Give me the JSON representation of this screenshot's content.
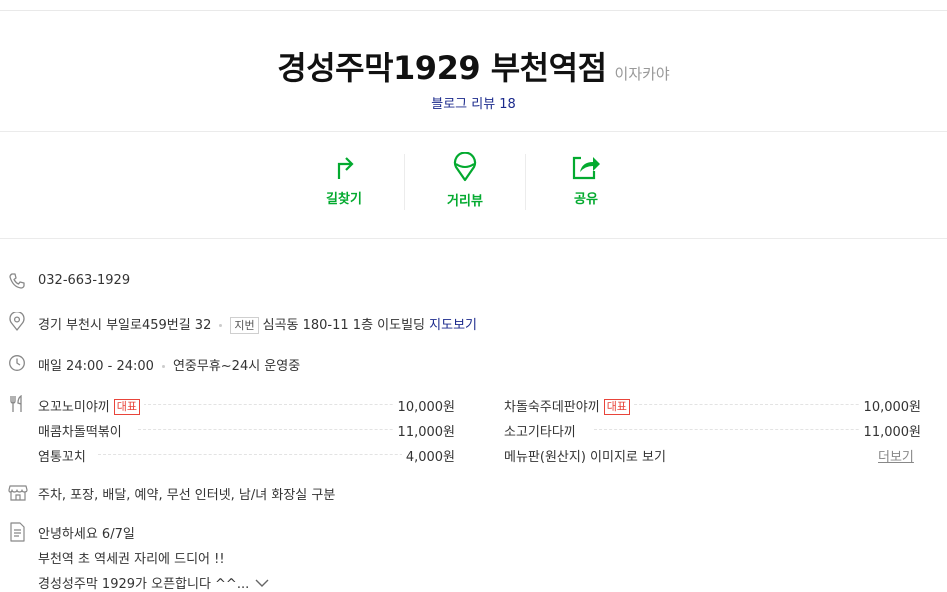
{
  "header": {
    "title": "경성주막1929 부천역점",
    "category": "이자카야",
    "review_label": "블로그 리뷰",
    "review_count": "18"
  },
  "actions": {
    "directions": "길찾기",
    "street_view": "거리뷰",
    "share": "공유"
  },
  "info": {
    "phone": "032-663-1929",
    "address_road": "경기 부천시 부일로459번길 32",
    "jibun_tag": "지번",
    "address_jibun": "심곡동 180-11 1층 이도빌딩",
    "map_link": "지도보기",
    "hours": "매일 24:00 - 24:00",
    "hours_note": "연중무휴~24시 운영중",
    "facilities": "주차, 포장, 배달, 예약, 무선 인터넷, 남/녀 화장실 구분"
  },
  "menu": {
    "rep_tag": "대표",
    "items": [
      {
        "name": "오꼬노미야끼",
        "price": "10,000원"
      },
      {
        "name": "차돌숙주데판야끼",
        "price": "10,000원"
      },
      {
        "name": "매콤차돌떡볶이",
        "price": "11,000원"
      },
      {
        "name": "소고기타다끼",
        "price": "11,000원"
      },
      {
        "name": "염통꼬치",
        "price": "4,000원"
      }
    ],
    "menu_image_link": "메뉴판(원산지) 이미지로 보기",
    "more": "더보기"
  },
  "description": {
    "line1": "안녕하세요  6/7일",
    "line2": "부천역 초 역세권 자리에 드디어 !!",
    "line3": "경성성주막 1929가 오픈합니다 ^^..."
  },
  "colors": {
    "accent_green": "#03aa2f",
    "link_navy": "#1b2a8c",
    "rep_red": "#e8443a"
  }
}
